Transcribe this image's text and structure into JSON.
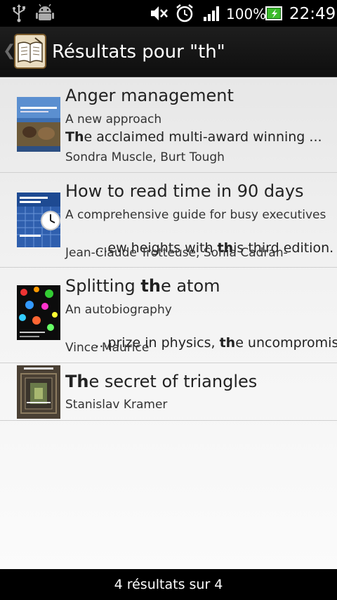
{
  "status_bar": {
    "icons": [
      "usb-icon",
      "android-debug-icon",
      "mute-icon",
      "alarm-icon",
      "signal-icon",
      "battery-icon"
    ],
    "battery": "100%",
    "time": "22:49"
  },
  "action_bar": {
    "title": "Résultats pour \"th\""
  },
  "results": [
    {
      "title_hl": "",
      "title_rest": "Anger management",
      "subtitle": "A new approach",
      "snippet_pre": "",
      "snippet_hl": "Th",
      "snippet_rest": "e acclaimed multi-award winning ...",
      "authors": "Sondra Muscle, Burt Tough"
    },
    {
      "title_hl": "",
      "title_rest": "How to read time in 90 days",
      "subtitle": "A comprehensive guide for busy executives",
      "snippet_pre": " ...ew heights with ",
      "snippet_hl": "th",
      "snippet_rest": "is third edition.",
      "authors": "Jean-Claude Trotteuse, Sonia Cadran-"
    },
    {
      "title_pre": "Splitting ",
      "title_hl": "th",
      "title_rest": "e atom",
      "subtitle": "An autobiography",
      "snippet_pre": " ...prize in physics, ",
      "snippet_hl": "th",
      "snippet_rest": "e uncompromis...",
      "authors": "Vince Maurice"
    },
    {
      "title_hl": "Th",
      "title_rest": "e secret of triangles",
      "authors": "Stanislav Kramer"
    }
  ],
  "footer": {
    "count_text": "4 résultats sur 4"
  }
}
